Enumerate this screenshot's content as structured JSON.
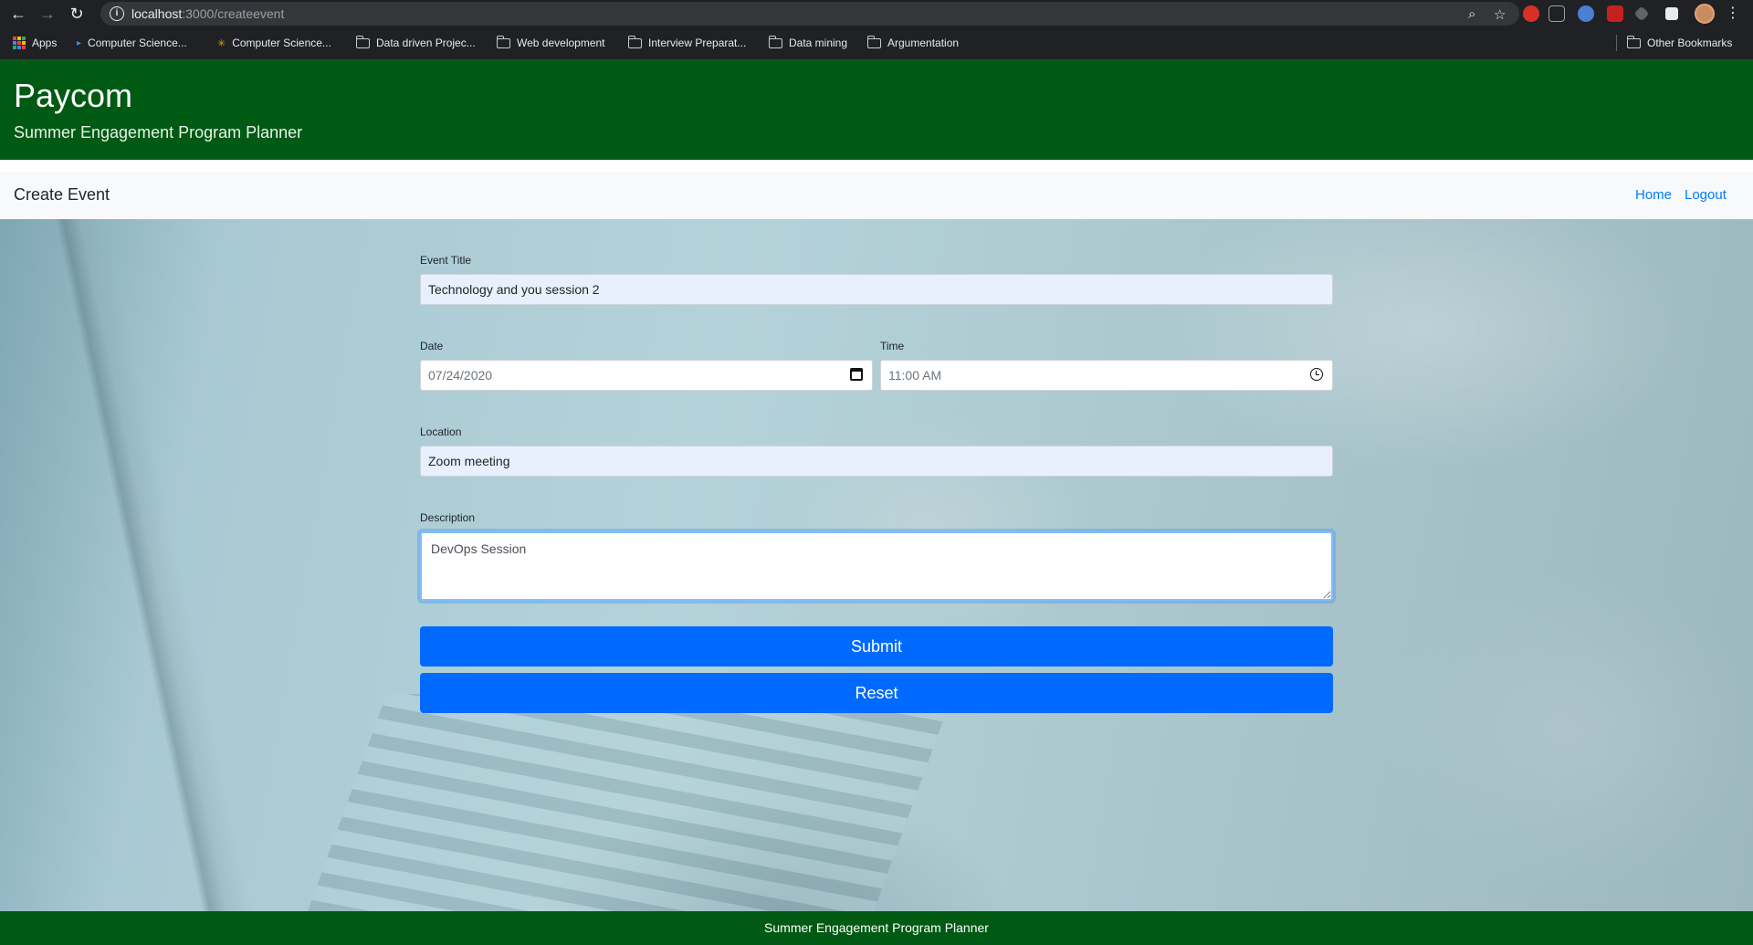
{
  "browser": {
    "url_host": "localhost",
    "url_path": ":3000/createevent",
    "bookmarks": {
      "apps": "Apps",
      "items": [
        "Computer Science...",
        "Computer Science...",
        "Data driven Projec...",
        "Web development",
        "Interview Preparat...",
        "Data mining",
        "Argumentation"
      ],
      "other": "Other Bookmarks"
    }
  },
  "header": {
    "brand": "Paycom",
    "tagline": "Summer Engagement Program Planner"
  },
  "navbar": {
    "title": "Create Event",
    "links": [
      "Home",
      "Logout"
    ]
  },
  "form": {
    "event_title_label": "Event Title",
    "event_title_value": "Technology and you session 2",
    "date_label": "Date",
    "date_value": "07/24/2020",
    "time_label": "Time",
    "time_value": "11:00  AM",
    "location_label": "Location",
    "location_value": "Zoom meeting",
    "description_label": "Description",
    "description_value": "DevOps Session",
    "submit_label": "Submit",
    "reset_label": "Reset"
  },
  "footer": {
    "text": "Summer Engagement Program Planner"
  },
  "colors": {
    "brand_green": "#005a13",
    "button_blue": "#006aff",
    "link_blue": "#007bff"
  }
}
